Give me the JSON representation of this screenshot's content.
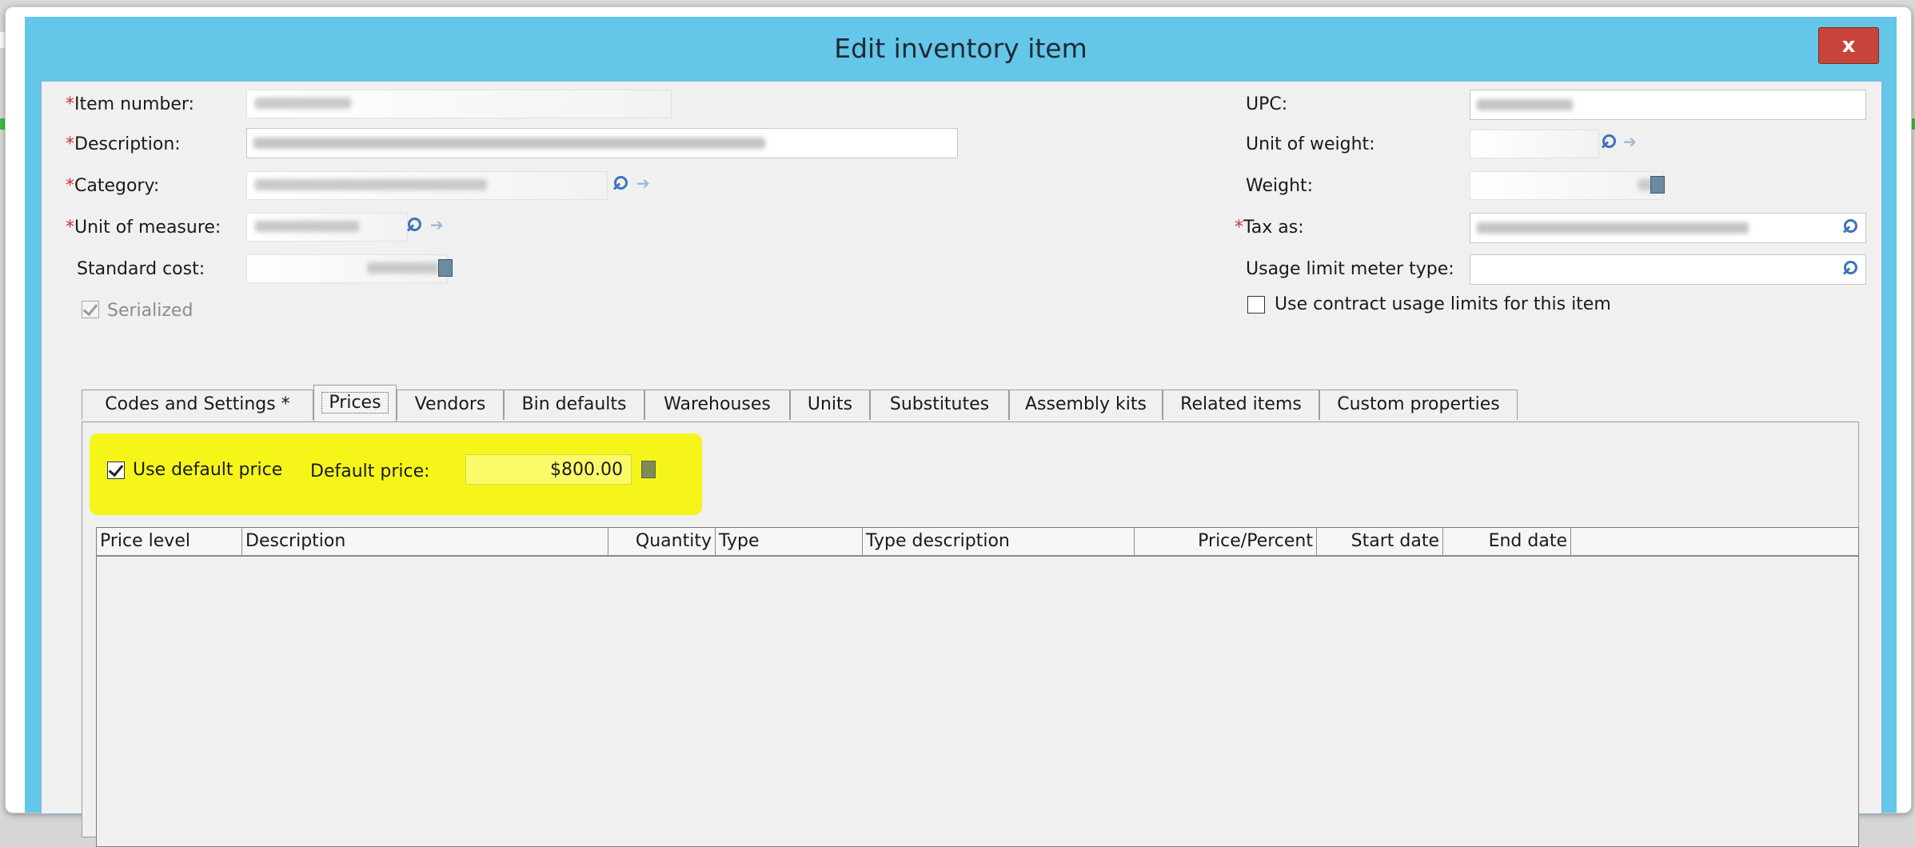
{
  "window": {
    "title": "Edit inventory item",
    "close_label": "x"
  },
  "fields_left": {
    "item_number_label": "Item number:",
    "description_label": "Description:",
    "category_label": "Category:",
    "unit_of_measure_label": "Unit of measure:",
    "standard_cost_label": "Standard cost:",
    "serialized_label": "Serialized",
    "required_mark": "*"
  },
  "fields_right": {
    "upc_label": "UPC:",
    "unit_of_weight_label": "Unit of weight:",
    "weight_label": "Weight:",
    "tax_as_label": "Tax as:",
    "usage_limit_meter_type_label": "Usage limit meter type:",
    "use_contract_usage_limits_label": "Use contract usage limits for this item"
  },
  "tabs": [
    {
      "label": "Codes and Settings  *"
    },
    {
      "label": "Prices"
    },
    {
      "label": "Vendors"
    },
    {
      "label": "Bin defaults"
    },
    {
      "label": "Warehouses"
    },
    {
      "label": "Units"
    },
    {
      "label": "Substitutes"
    },
    {
      "label": "Assembly kits"
    },
    {
      "label": "Related items"
    },
    {
      "label": "Custom properties"
    }
  ],
  "prices": {
    "use_default_price_label": "Use default price",
    "use_default_price_checked": true,
    "default_price_label": "Default price:",
    "default_price_value": "$800.00"
  },
  "grid": {
    "columns": [
      "Price level",
      "Description",
      "Quantity",
      "Type",
      "Type description",
      "Price/Percent",
      "Start date",
      "End date"
    ]
  },
  "colors": {
    "title_bar": "#64c6e8",
    "close_button": "#c7443a",
    "highlight": "#f5f51a",
    "required_asterisk": "#d23030"
  }
}
